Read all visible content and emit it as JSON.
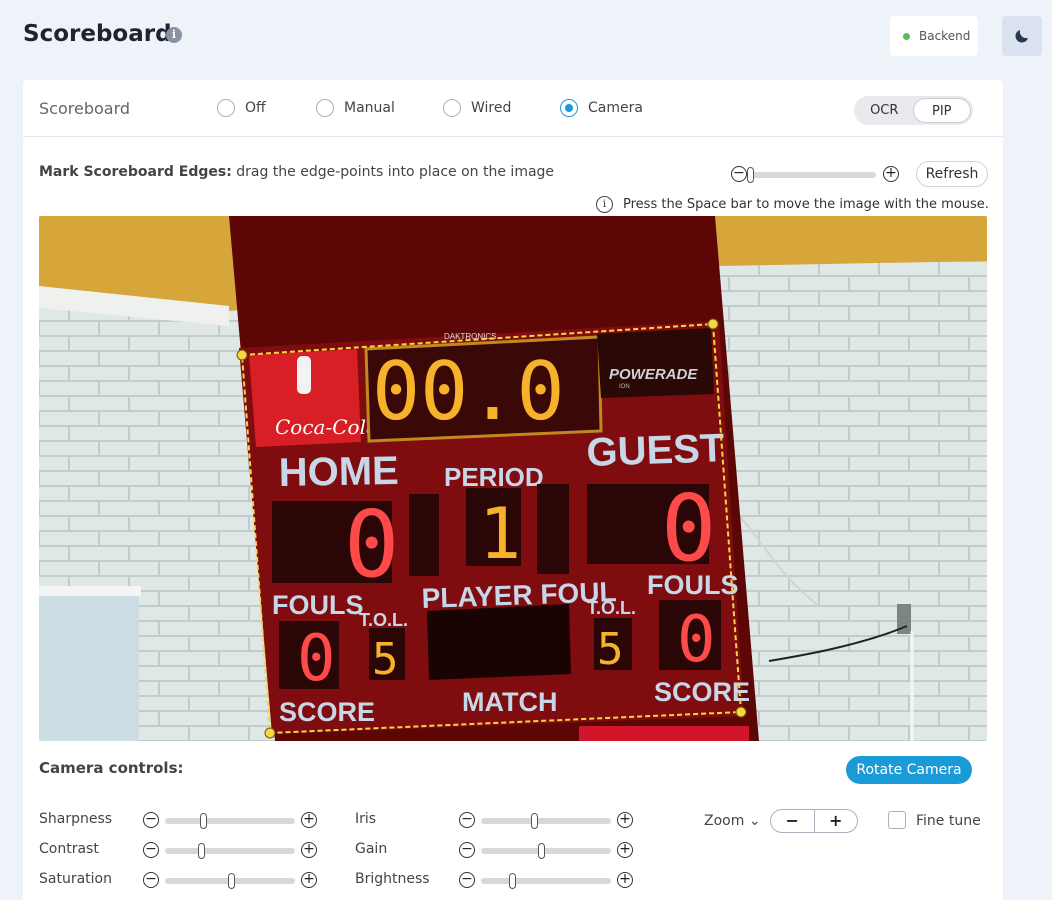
{
  "header": {
    "title": "Scoreboard",
    "backend_label": "Backend",
    "colors": {
      "backend_status": "#5cb85c",
      "accent": "#1a9bd7"
    }
  },
  "source": {
    "label": "Scoreboard",
    "options": [
      {
        "label": "Off",
        "selected": false
      },
      {
        "label": "Manual",
        "selected": false
      },
      {
        "label": "Wired",
        "selected": false
      },
      {
        "label": "Camera",
        "selected": true
      }
    ],
    "mode_toggle": [
      {
        "label": "OCR",
        "active": false
      },
      {
        "label": "PIP",
        "active": true
      }
    ]
  },
  "mark": {
    "title_bold": "Mark Scoreboard Edges:",
    "title_rest": " drag the edge-points into place on the image",
    "refresh_label": "Refresh",
    "zoom_level": 0,
    "hint": "Press the Space bar to move the image with the mouse."
  },
  "scoreboard_image": {
    "brand_top": "DAKTRONICS",
    "clock": "00.0",
    "sponsor_left": "Coca-Cola",
    "sponsor_right": "POWERADE",
    "sponsor_right_sub": "ION",
    "home_label": "HOME",
    "guest_label": "GUEST",
    "period_label": "PERIOD",
    "home_score": "0",
    "guest_score": "0",
    "period": "1",
    "fouls_label_left": "FOULS",
    "fouls_label_right": "FOULS",
    "tol_label_left": "T.O.L.",
    "tol_label_right": "T.O.L.",
    "player_foul_label": "PLAYER FOUL",
    "home_fouls": "0",
    "guest_fouls": "0",
    "home_tol": "5",
    "guest_tol": "5",
    "score_label_left": "SCORE",
    "score_label_right": "SCORE",
    "match_label": "MATCH"
  },
  "camera": {
    "title": "Camera controls:",
    "rotate_label": "Rotate Camera",
    "controls_left": [
      {
        "label": "Sharpness",
        "value": 0.28
      },
      {
        "label": "Contrast",
        "value": 0.26
      },
      {
        "label": "Saturation",
        "value": 0.5
      }
    ],
    "controls_right": [
      {
        "label": "Iris",
        "value": 0.4
      },
      {
        "label": "Gain",
        "value": 0.45
      },
      {
        "label": "Brightness",
        "value": 0.22
      }
    ],
    "zoom_label": "Zoom",
    "zoom_minus": "−",
    "zoom_plus": "+",
    "fine_tune_label": "Fine tune",
    "fine_tune_checked": false
  }
}
